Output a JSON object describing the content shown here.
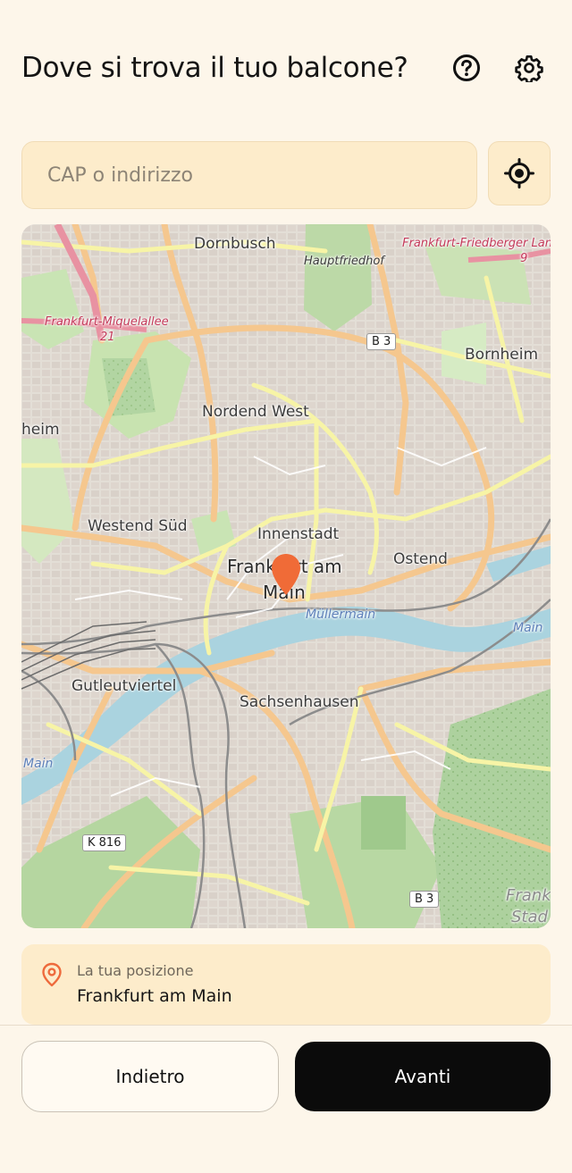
{
  "header": {
    "title": "Dove si trova il tuo balcone?",
    "help_icon": "help-circle-icon",
    "settings_icon": "gear-icon"
  },
  "search": {
    "placeholder": "CAP o indirizzo",
    "value": "",
    "locate_icon": "crosshair-locate-icon"
  },
  "map": {
    "labels": {
      "dornbusch": "Dornbusch",
      "hauptfriedhof": "Hauptfriedhof",
      "friedberger": "Frankfurt-Friedberger Lan",
      "friedberger_num": "9",
      "miquelallee": "Frankfurt-Miquelallee",
      "miquel_num": "21",
      "b3_top": "B 3",
      "bornheim": "Bornheim",
      "nordend": "Nordend West",
      "heim": "heim",
      "westend": "Westend Süd",
      "innenstadt": "Innenstadt",
      "frankfurt_line1": "Frankfurt am",
      "frankfurt_line2": "Main",
      "ostend": "Ostend",
      "mullermain": "Müllermain",
      "main_right": "Main",
      "gutleut": "Gutleutviertel",
      "sachsenhausen": "Sachsenhausen",
      "main_left": "Main",
      "k816": "K 816",
      "b3_bottom": "B 3",
      "frank_stad_1": "Frank",
      "frank_stad_2": "Stad"
    },
    "pin_icon": "map-pin-icon",
    "colors": {
      "pin": "#f06b37",
      "water": "#aad3df",
      "road_major": "#f5c78e",
      "road_yellow": "#f7f4a6"
    }
  },
  "location": {
    "caption": "La tua posizione",
    "value": "Frankfurt am Main",
    "icon": "location-pin-icon"
  },
  "footer": {
    "back_label": "Indietro",
    "next_label": "Avanti"
  }
}
